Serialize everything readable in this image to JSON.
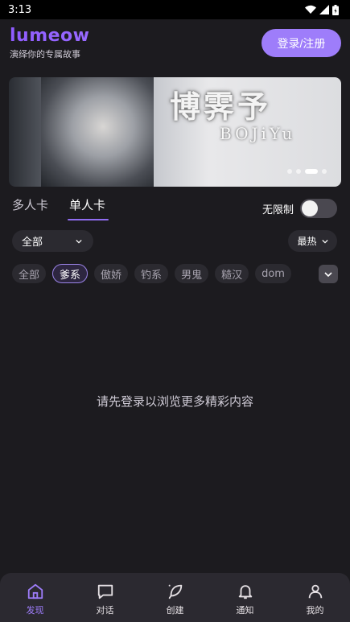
{
  "status": {
    "time": "3:13"
  },
  "app": {
    "name": "lumeow",
    "tagline": "演绎你的专属故事",
    "login_label": "登录/注册"
  },
  "banner": {
    "title": "博霁予",
    "subtitle": "BOJiYu"
  },
  "tabs": [
    {
      "label": "多人卡",
      "active": false
    },
    {
      "label": "单人卡",
      "active": true
    }
  ],
  "unlimited": {
    "label": "无限制",
    "enabled": false
  },
  "filters": {
    "category": "全部",
    "sort": "最热"
  },
  "chips": [
    "全部",
    "爹系",
    "傲娇",
    "钓系",
    "男鬼",
    "糙汉",
    "dom"
  ],
  "active_chip": "爹系",
  "empty_message": "请先登录以浏览更多精彩内容",
  "nav": [
    {
      "label": "发现",
      "icon": "home-icon",
      "active": true
    },
    {
      "label": "对话",
      "icon": "chat-icon",
      "active": false
    },
    {
      "label": "创建",
      "icon": "feather-icon",
      "active": false
    },
    {
      "label": "通知",
      "icon": "bell-icon",
      "active": false
    },
    {
      "label": "我的",
      "icon": "user-icon",
      "active": false
    }
  ],
  "colors": {
    "accent": "#9e7dfa",
    "background": "#1c1b1f",
    "surface": "#2b2930"
  }
}
